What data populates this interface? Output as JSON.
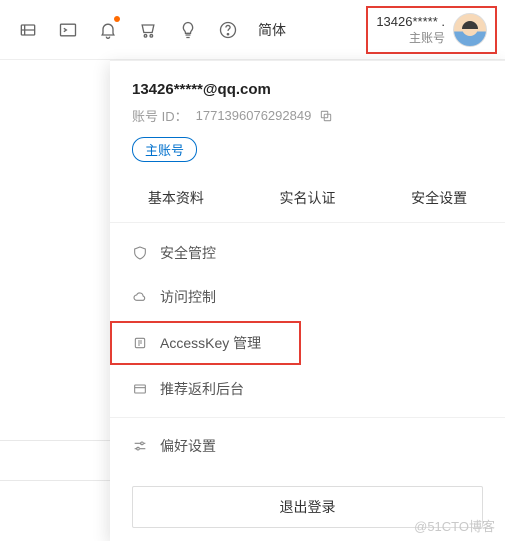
{
  "topbar": {
    "lang_label": "简体",
    "account_name": "13426***** .",
    "account_type": "主账号"
  },
  "dropdown": {
    "email": "13426*****@qq.com",
    "id_label": "账号 ID：",
    "id_value": "1771396076292849",
    "badge": "主账号",
    "tabs": [
      "基本资料",
      "实名认证",
      "安全设置"
    ],
    "menu": {
      "security": "安全管控",
      "access_control": "访问控制",
      "accesskey": "AccessKey 管理",
      "referral": "推荐返利后台",
      "preferences": "偏好设置"
    },
    "logout": "退出登录"
  },
  "watermark": "@51CTO博客"
}
